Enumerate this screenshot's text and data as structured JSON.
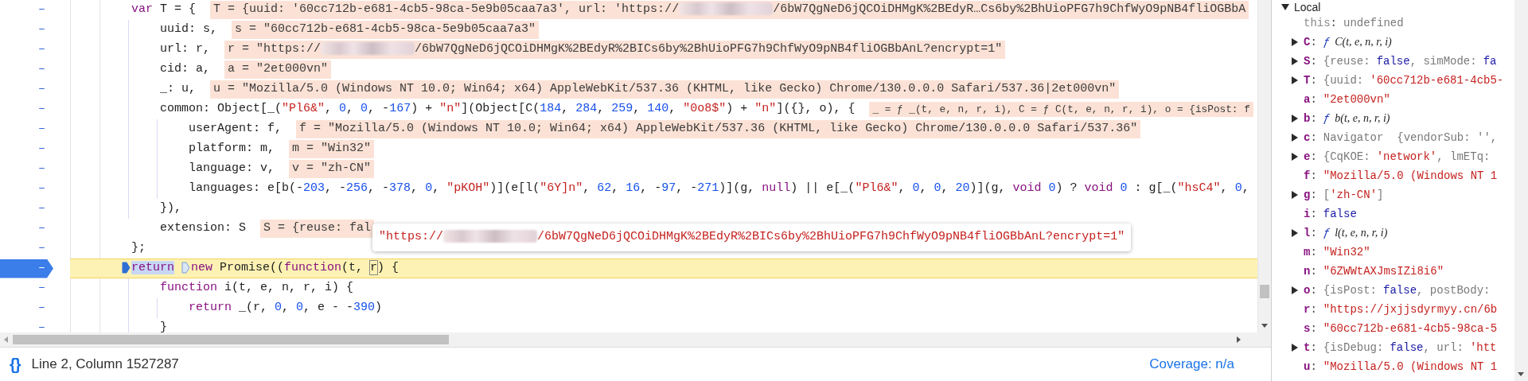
{
  "editor": {
    "lines": [
      {
        "gutter": "–",
        "breakpoint": false,
        "current": false,
        "tokens": [
          {
            "kind": "kw",
            "t": "var"
          },
          {
            "kind": "plain",
            "t": " T = {"
          }
        ],
        "inline_value": [
          {
            "kind": "text",
            "text": "T = {uuid: '60cc712b-e681-4cb5-98ca-5e9b05caa7a3', url: 'https://"
          },
          {
            "kind": "blur"
          },
          {
            "kind": "text",
            "text": "/6bW7QgNeD6jQCOiDHMgK%2BEdyR…Cs6by%2BhUioPFG7h9ChfWyO9pNB4fliOGBbA"
          }
        ],
        "children": [
          {
            "gutter": "–",
            "breakpoint": false,
            "current": false,
            "tokens": [
              {
                "kind": "plain",
                "t": "uuid: s,"
              }
            ],
            "inline_value": [
              {
                "kind": "text",
                "text": "s = \"60cc712b-e681-4cb5-98ca-5e9b05caa7a3\""
              }
            ]
          },
          {
            "gutter": "–",
            "breakpoint": false,
            "current": false,
            "tokens": [
              {
                "kind": "plain",
                "t": "url: r,"
              }
            ],
            "inline_value": [
              {
                "kind": "text",
                "text": "r = \"https://"
              },
              {
                "kind": "blur"
              },
              {
                "kind": "text",
                "text": "/6bW7QgNeD6jQCOiDHMgK%2BEdyR%2BICs6by%2BhUioPFG7h9ChfWyO9pNB4fliOGBbAnL?encrypt=1\""
              }
            ]
          },
          {
            "gutter": "–",
            "breakpoint": false,
            "current": false,
            "tokens": [
              {
                "kind": "plain",
                "t": "cid: a,"
              }
            ],
            "inline_value": [
              {
                "kind": "text",
                "text": "a = \"2et000vn\""
              }
            ]
          },
          {
            "gutter": "–",
            "breakpoint": false,
            "current": false,
            "tokens": [
              {
                "kind": "plain",
                "t": "_: u,"
              }
            ],
            "inline_value": [
              {
                "kind": "text",
                "text": "u = \"Mozilla/5.0 (Windows NT 10.0; Win64; x64) AppleWebKit/537.36 (KHTML, like Gecko) Chrome/130.0.0.0 Safari/537.36|2et000vn\""
              }
            ]
          },
          {
            "gutter": "–",
            "breakpoint": false,
            "current": false,
            "tokens": [
              {
                "kind": "plain",
                "t": "common: Object[_("
              },
              {
                "kind": "str",
                "t": "\"Pl6&\""
              },
              {
                "kind": "plain",
                "t": ", "
              },
              {
                "kind": "num",
                "t": "0"
              },
              {
                "kind": "plain",
                "t": ", "
              },
              {
                "kind": "num",
                "t": "0"
              },
              {
                "kind": "plain",
                "t": ", -"
              },
              {
                "kind": "num",
                "t": "167"
              },
              {
                "kind": "plain",
                "t": ") + "
              },
              {
                "kind": "str",
                "t": "\"n\""
              },
              {
                "kind": "plain",
                "t": "](Object[C("
              },
              {
                "kind": "num",
                "t": "184"
              },
              {
                "kind": "plain",
                "t": ", "
              },
              {
                "kind": "num",
                "t": "284"
              },
              {
                "kind": "plain",
                "t": ", "
              },
              {
                "kind": "num",
                "t": "259"
              },
              {
                "kind": "plain",
                "t": ", "
              },
              {
                "kind": "num",
                "t": "140"
              },
              {
                "kind": "plain",
                "t": ", "
              },
              {
                "kind": "str",
                "t": "\"0o8$\""
              },
              {
                "kind": "plain",
                "t": ") + "
              },
              {
                "kind": "str",
                "t": "\"n\""
              },
              {
                "kind": "plain",
                "t": "]({}, o), {"
              }
            ],
            "inline_value": [
              {
                "kind": "text",
                "text": "_ = ƒ _(t, e, n, r, i), C = ƒ C(t, e, n, r, i), o = {isPost: f"
              }
            ],
            "children": [
              {
                "gutter": "–",
                "breakpoint": false,
                "current": false,
                "tokens": [
                  {
                    "kind": "plain",
                    "t": "userAgent: f,"
                  }
                ],
                "inline_value": [
                  {
                    "kind": "text",
                    "text": "f = \"Mozilla/5.0 (Windows NT 10.0; Win64; x64) AppleWebKit/537.36 (KHTML, like Gecko) Chrome/130.0.0.0 Safari/537.36\""
                  }
                ]
              },
              {
                "gutter": "–",
                "breakpoint": false,
                "current": false,
                "tokens": [
                  {
                    "kind": "plain",
                    "t": "platform: m,"
                  }
                ],
                "inline_value": [
                  {
                    "kind": "text",
                    "text": "m = \"Win32\""
                  }
                ]
              },
              {
                "gutter": "–",
                "breakpoint": false,
                "current": false,
                "tokens": [
                  {
                    "kind": "plain",
                    "t": "language: v,"
                  }
                ],
                "inline_value": [
                  {
                    "kind": "text",
                    "text": "v = \"zh-CN\""
                  }
                ]
              },
              {
                "gutter": "–",
                "breakpoint": false,
                "current": false,
                "tokens": [
                  {
                    "kind": "plain",
                    "t": "languages: e[b(-"
                  },
                  {
                    "kind": "num",
                    "t": "203"
                  },
                  {
                    "kind": "plain",
                    "t": ", -"
                  },
                  {
                    "kind": "num",
                    "t": "256"
                  },
                  {
                    "kind": "plain",
                    "t": ", -"
                  },
                  {
                    "kind": "num",
                    "t": "378"
                  },
                  {
                    "kind": "plain",
                    "t": ", "
                  },
                  {
                    "kind": "num",
                    "t": "0"
                  },
                  {
                    "kind": "plain",
                    "t": ", "
                  },
                  {
                    "kind": "str",
                    "t": "\"pKOH\""
                  },
                  {
                    "kind": "plain",
                    "t": ")](e[l("
                  },
                  {
                    "kind": "str",
                    "t": "\"6Y]n\""
                  },
                  {
                    "kind": "plain",
                    "t": ", "
                  },
                  {
                    "kind": "num",
                    "t": "62"
                  },
                  {
                    "kind": "plain",
                    "t": ", "
                  },
                  {
                    "kind": "num",
                    "t": "16"
                  },
                  {
                    "kind": "plain",
                    "t": ", -"
                  },
                  {
                    "kind": "num",
                    "t": "97"
                  },
                  {
                    "kind": "plain",
                    "t": ", -"
                  },
                  {
                    "kind": "num",
                    "t": "271"
                  },
                  {
                    "kind": "plain",
                    "t": ")](g, "
                  },
                  {
                    "kind": "kw",
                    "t": "null"
                  },
                  {
                    "kind": "plain",
                    "t": ") || e[_("
                  },
                  {
                    "kind": "str",
                    "t": "\"Pl6&\""
                  },
                  {
                    "kind": "plain",
                    "t": ", "
                  },
                  {
                    "kind": "num",
                    "t": "0"
                  },
                  {
                    "kind": "plain",
                    "t": ", "
                  },
                  {
                    "kind": "num",
                    "t": "0"
                  },
                  {
                    "kind": "plain",
                    "t": ", "
                  },
                  {
                    "kind": "num",
                    "t": "20"
                  },
                  {
                    "kind": "plain",
                    "t": ")](g, "
                  },
                  {
                    "kind": "kw",
                    "t": "void"
                  },
                  {
                    "kind": "num",
                    "t": " 0"
                  },
                  {
                    "kind": "plain",
                    "t": ") ? "
                  },
                  {
                    "kind": "kw",
                    "t": "void"
                  },
                  {
                    "kind": "num",
                    "t": " 0"
                  },
                  {
                    "kind": "plain",
                    "t": " : g[_("
                  },
                  {
                    "kind": "str",
                    "t": "\"hsC4\""
                  },
                  {
                    "kind": "plain",
                    "t": ", "
                  },
                  {
                    "kind": "num",
                    "t": "0"
                  },
                  {
                    "kind": "plain",
                    "t": ","
                  }
                ]
              }
            ]
          },
          {
            "gutter": "–",
            "breakpoint": false,
            "current": false,
            "tokens": [
              {
                "kind": "plain",
                "t": "}),"
              }
            ]
          },
          {
            "gutter": "–",
            "breakpoint": false,
            "current": false,
            "tokens": [
              {
                "kind": "plain",
                "t": "extension: S"
              }
            ],
            "inline_value": [
              {
                "kind": "text",
                "text": "S = {reuse: fal"
              }
            ]
          }
        ]
      },
      {
        "gutter": "–",
        "breakpoint": false,
        "current": false,
        "tokens": [
          {
            "kind": "plain",
            "t": "};"
          }
        ]
      },
      {
        "gutter": "–",
        "breakpoint": true,
        "current": true,
        "tokens": [
          {
            "kind": "marker",
            "on": true
          },
          {
            "kind": "selected",
            "t": "return"
          },
          {
            "kind": "marker",
            "on": false
          },
          {
            "kind": "kw",
            "t": "new"
          },
          {
            "kind": "plain",
            "t": " Promise(("
          },
          {
            "kind": "kw",
            "t": "function"
          },
          {
            "kind": "plain",
            "t": "(t, "
          },
          {
            "kind": "hovered",
            "t": "r"
          },
          {
            "kind": "plain",
            "t": ") {"
          }
        ],
        "children": [
          {
            "gutter": "–",
            "breakpoint": false,
            "current": false,
            "tokens": [
              {
                "kind": "kw",
                "t": "function"
              },
              {
                "kind": "plain",
                "t": " i(t, e, n, r, i) {"
              }
            ],
            "children": [
              {
                "gutter": "–",
                "breakpoint": false,
                "current": false,
                "tokens": [
                  {
                    "kind": "kw",
                    "t": "return"
                  },
                  {
                    "kind": "plain",
                    "t": " _(r, "
                  },
                  {
                    "kind": "num",
                    "t": "0"
                  },
                  {
                    "kind": "plain",
                    "t": ", "
                  },
                  {
                    "kind": "num",
                    "t": "0"
                  },
                  {
                    "kind": "plain",
                    "t": ", e - -"
                  },
                  {
                    "kind": "num",
                    "t": "390"
                  },
                  {
                    "kind": "plain",
                    "t": ")"
                  }
                ]
              }
            ]
          },
          {
            "gutter": "–",
            "breakpoint": false,
            "current": false,
            "tokens": [
              {
                "kind": "plain",
                "t": "}"
              }
            ]
          }
        ]
      }
    ],
    "tooltip": [
      {
        "kind": "text",
        "text": "\"https://"
      },
      {
        "kind": "blur"
      },
      {
        "kind": "text",
        "text": "/6bW7QgNeD6jQCOiDHMgK%2BEdyR%2BICs6by%2BhUioPFG7h9ChfWyO9pNB4fliOGBbAnL?encrypt=1\""
      }
    ]
  },
  "status_bar": {
    "format_button": "{}",
    "position": "Line 2, Column 1527287",
    "coverage": "Coverage: n/a"
  },
  "scope": {
    "section": {
      "title": "Local",
      "expanded": true
    },
    "entries": [
      {
        "key": "this",
        "expandable": false,
        "muted": true,
        "value": [
          {
            "kind": "punct",
            "t": ":"
          },
          {
            "kind": "gray",
            "t": "undefined"
          }
        ]
      },
      {
        "key": "C",
        "expandable": true,
        "muted": false,
        "value": [
          {
            "kind": "punct",
            "t": ":"
          },
          {
            "kind": "f",
            "t": "ƒ"
          },
          {
            "kind": "fnsig",
            "t": "C(t, e, n, r, i)"
          }
        ]
      },
      {
        "key": "S",
        "expandable": true,
        "muted": false,
        "value": [
          {
            "kind": "punct",
            "t": ":"
          },
          {
            "kind": "gray",
            "t": "{reuse:"
          },
          {
            "kind": "bool",
            "t": "false"
          },
          {
            "kind": "gray",
            "t": ", simMode:"
          },
          {
            "kind": "bool",
            "t": "fa"
          }
        ]
      },
      {
        "key": "T",
        "expandable": true,
        "muted": false,
        "value": [
          {
            "kind": "punct",
            "t": ":"
          },
          {
            "kind": "gray",
            "t": "{uuid:"
          },
          {
            "kind": "str",
            "t": "'60cc712b-e681-4cb5-"
          }
        ]
      },
      {
        "key": "a",
        "expandable": false,
        "muted": false,
        "value": [
          {
            "kind": "punct",
            "t": ":"
          },
          {
            "kind": "str",
            "t": "\"2et000vn\""
          }
        ]
      },
      {
        "key": "b",
        "expandable": true,
        "muted": false,
        "value": [
          {
            "kind": "punct",
            "t": ":"
          },
          {
            "kind": "f",
            "t": "ƒ"
          },
          {
            "kind": "fnsig",
            "t": "b(t, e, n, r, i)"
          }
        ]
      },
      {
        "key": "c",
        "expandable": true,
        "muted": false,
        "value": [
          {
            "kind": "punct",
            "t": ":"
          },
          {
            "kind": "gray",
            "t": "Navigator  {vendorSub: '',"
          }
        ]
      },
      {
        "key": "e",
        "expandable": true,
        "muted": false,
        "value": [
          {
            "kind": "punct",
            "t": ":"
          },
          {
            "kind": "gray",
            "t": "{CqKOE:"
          },
          {
            "kind": "str",
            "t": "'network'"
          },
          {
            "kind": "gray",
            "t": ", lmETq:"
          }
        ]
      },
      {
        "key": "f",
        "expandable": false,
        "muted": false,
        "value": [
          {
            "kind": "punct",
            "t": ":"
          },
          {
            "kind": "str",
            "t": "\"Mozilla/5.0 (Windows NT 1"
          }
        ]
      },
      {
        "key": "g",
        "expandable": true,
        "muted": false,
        "value": [
          {
            "kind": "punct",
            "t": ":"
          },
          {
            "kind": "gray",
            "t": "["
          },
          {
            "kind": "str",
            "t": "'zh-CN'"
          },
          {
            "kind": "gray",
            "t": "]"
          }
        ]
      },
      {
        "key": "i",
        "expandable": false,
        "muted": false,
        "value": [
          {
            "kind": "punct",
            "t": ":"
          },
          {
            "kind": "bool",
            "t": "false"
          }
        ]
      },
      {
        "key": "l",
        "expandable": true,
        "muted": false,
        "value": [
          {
            "kind": "punct",
            "t": ":"
          },
          {
            "kind": "f",
            "t": "ƒ"
          },
          {
            "kind": "fnsig",
            "t": "l(t, e, n, r, i)"
          }
        ]
      },
      {
        "key": "m",
        "expandable": false,
        "muted": false,
        "value": [
          {
            "kind": "punct",
            "t": ":"
          },
          {
            "kind": "str",
            "t": "\"Win32\""
          }
        ]
      },
      {
        "key": "n",
        "expandable": false,
        "muted": false,
        "value": [
          {
            "kind": "punct",
            "t": ":"
          },
          {
            "kind": "str",
            "t": "\"6ZWWtAXJmsIZi8i6\""
          }
        ]
      },
      {
        "key": "o",
        "expandable": true,
        "muted": false,
        "value": [
          {
            "kind": "punct",
            "t": ":"
          },
          {
            "kind": "gray",
            "t": "{isPost:"
          },
          {
            "kind": "bool",
            "t": "false"
          },
          {
            "kind": "gray",
            "t": ", postBody:"
          }
        ]
      },
      {
        "key": "r",
        "expandable": false,
        "muted": false,
        "value": [
          {
            "kind": "punct",
            "t": ":"
          },
          {
            "kind": "str",
            "t": "\"https://jxjjsdyrmyy.cn/6b"
          }
        ]
      },
      {
        "key": "s",
        "expandable": false,
        "muted": false,
        "value": [
          {
            "kind": "punct",
            "t": ":"
          },
          {
            "kind": "str",
            "t": "\"60cc712b-e681-4cb5-98ca-5"
          }
        ]
      },
      {
        "key": "t",
        "expandable": true,
        "muted": false,
        "value": [
          {
            "kind": "punct",
            "t": ":"
          },
          {
            "kind": "gray",
            "t": "{isDebug:"
          },
          {
            "kind": "bool",
            "t": "false"
          },
          {
            "kind": "gray",
            "t": ", url:"
          },
          {
            "kind": "str",
            "t": "'htt"
          }
        ]
      },
      {
        "key": "u",
        "expandable": false,
        "muted": false,
        "value": [
          {
            "kind": "punct",
            "t": ":"
          },
          {
            "kind": "str",
            "t": "\"Mozilla/5.0 (Windows NT 1"
          }
        ]
      }
    ]
  }
}
